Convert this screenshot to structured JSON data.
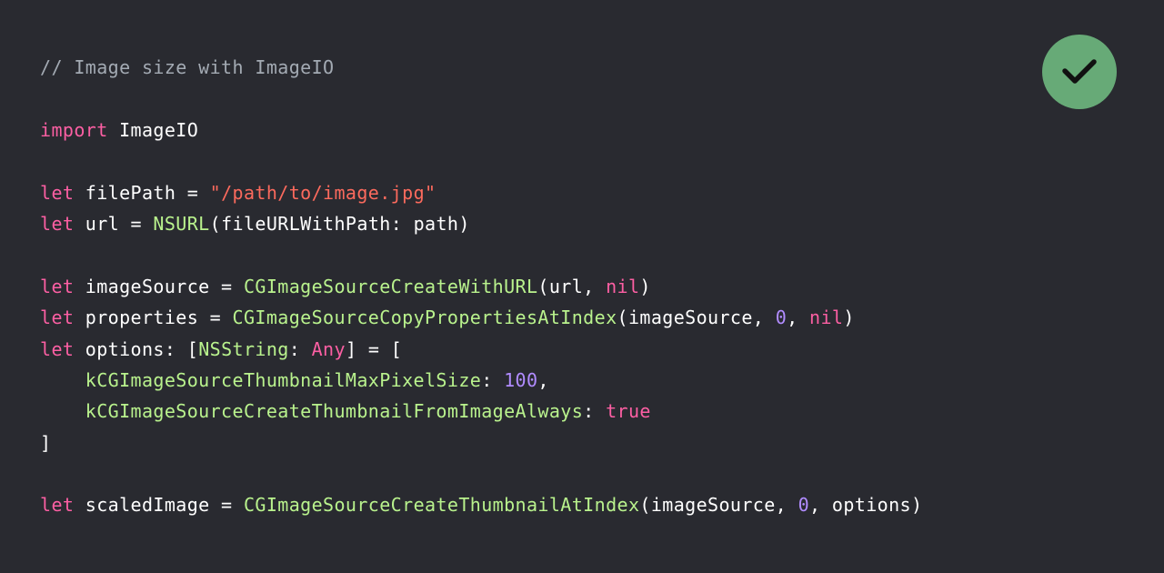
{
  "colors": {
    "background": "#292a30",
    "comment": "#a3aab3",
    "keyword": "#fc5fa3",
    "string": "#fc6a5d",
    "type": "#b9f28d",
    "number": "#b18cff",
    "plain": "#ffffff",
    "badge": "#67aa77"
  },
  "badge": {
    "icon": "checkmark-icon"
  },
  "code": {
    "lines": [
      [
        {
          "t": "// Image size with ImageIO",
          "c": "comment"
        }
      ],
      [],
      [
        {
          "t": "import",
          "c": "keyword"
        },
        {
          "t": " ImageIO",
          "c": "plain"
        }
      ],
      [],
      [
        {
          "t": "let",
          "c": "keyword"
        },
        {
          "t": " filePath = ",
          "c": "plain"
        },
        {
          "t": "\"/path/to/image.jpg\"",
          "c": "string"
        }
      ],
      [
        {
          "t": "let",
          "c": "keyword"
        },
        {
          "t": " url = ",
          "c": "plain"
        },
        {
          "t": "NSURL",
          "c": "type"
        },
        {
          "t": "(fileURLWithPath: path)",
          "c": "plain"
        }
      ],
      [],
      [
        {
          "t": "let",
          "c": "keyword"
        },
        {
          "t": " imageSource = ",
          "c": "plain"
        },
        {
          "t": "CGImageSourceCreateWithURL",
          "c": "func"
        },
        {
          "t": "(url, ",
          "c": "plain"
        },
        {
          "t": "nil",
          "c": "keyword"
        },
        {
          "t": ")",
          "c": "plain"
        }
      ],
      [
        {
          "t": "let",
          "c": "keyword"
        },
        {
          "t": " properties = ",
          "c": "plain"
        },
        {
          "t": "CGImageSourceCopyPropertiesAtIndex",
          "c": "func"
        },
        {
          "t": "(imageSource, ",
          "c": "plain"
        },
        {
          "t": "0",
          "c": "number"
        },
        {
          "t": ", ",
          "c": "plain"
        },
        {
          "t": "nil",
          "c": "keyword"
        },
        {
          "t": ")",
          "c": "plain"
        }
      ],
      [
        {
          "t": "let",
          "c": "keyword"
        },
        {
          "t": " options: [",
          "c": "plain"
        },
        {
          "t": "NSString",
          "c": "type"
        },
        {
          "t": ": ",
          "c": "plain"
        },
        {
          "t": "Any",
          "c": "keyword"
        },
        {
          "t": "] = [",
          "c": "plain"
        }
      ],
      [
        {
          "t": "    ",
          "c": "plain"
        },
        {
          "t": "kCGImageSourceThumbnailMaxPixelSize",
          "c": "func"
        },
        {
          "t": ": ",
          "c": "plain"
        },
        {
          "t": "100",
          "c": "number"
        },
        {
          "t": ",",
          "c": "plain"
        }
      ],
      [
        {
          "t": "    ",
          "c": "plain"
        },
        {
          "t": "kCGImageSourceCreateThumbnailFromImageAlways",
          "c": "func"
        },
        {
          "t": ": ",
          "c": "plain"
        },
        {
          "t": "true",
          "c": "keyword"
        }
      ],
      [
        {
          "t": "]",
          "c": "plain"
        }
      ],
      [],
      [
        {
          "t": "let",
          "c": "keyword"
        },
        {
          "t": " scaledImage = ",
          "c": "plain"
        },
        {
          "t": "CGImageSourceCreateThumbnailAtIndex",
          "c": "func"
        },
        {
          "t": "(imageSource, ",
          "c": "plain"
        },
        {
          "t": "0",
          "c": "number"
        },
        {
          "t": ", options)",
          "c": "plain"
        }
      ]
    ]
  }
}
